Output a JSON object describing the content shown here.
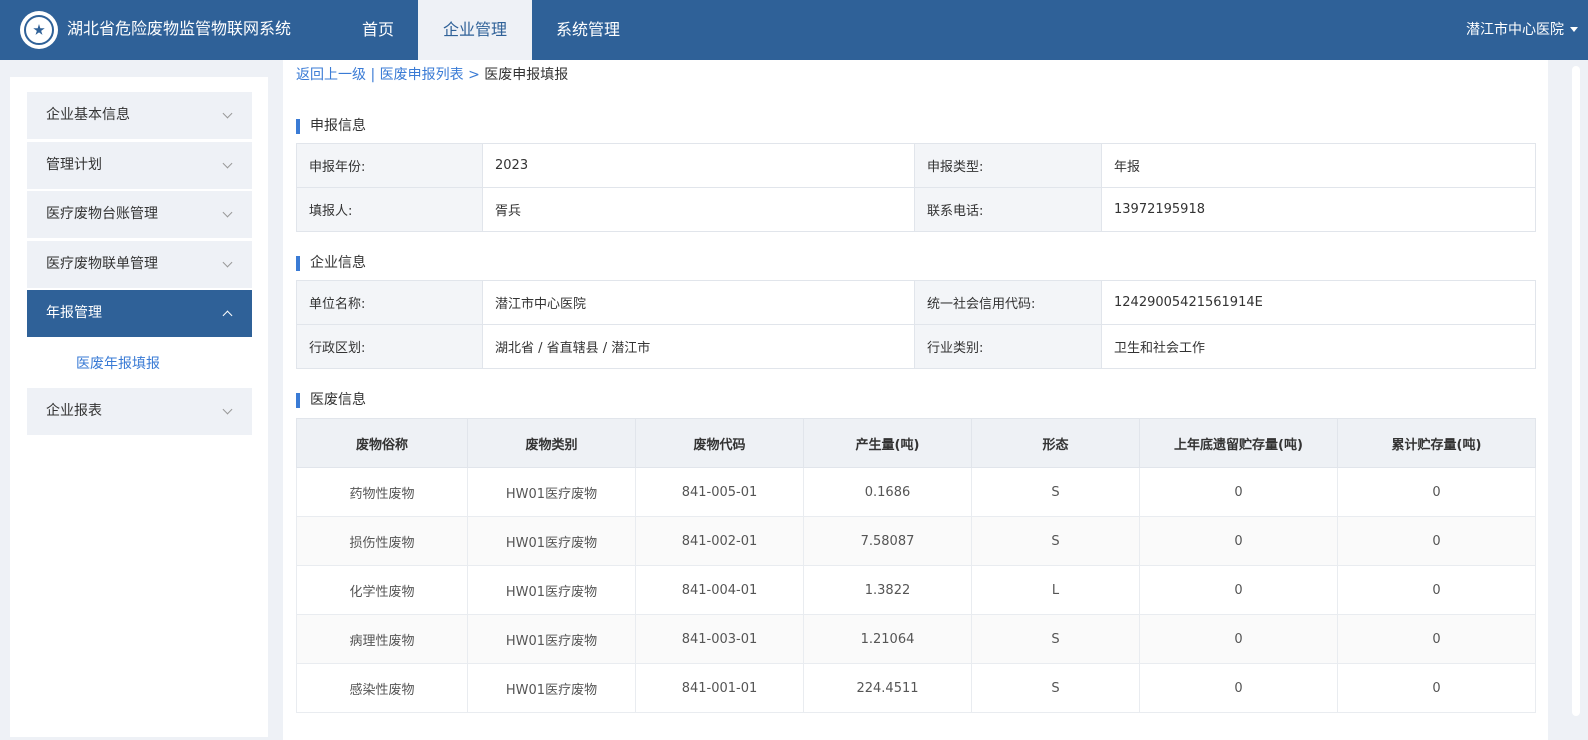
{
  "header": {
    "app_title": "湖北省危险废物监管物联网系统",
    "nav": [
      {
        "label": "首页"
      },
      {
        "label": "企业管理",
        "active": true
      },
      {
        "label": "系统管理"
      }
    ],
    "user": "潜江市中心医院"
  },
  "sidebar": {
    "items": [
      {
        "label": "企业基本信息"
      },
      {
        "label": "管理计划"
      },
      {
        "label": "医疗废物台账管理"
      },
      {
        "label": "医疗废物联单管理"
      },
      {
        "label": "年报管理",
        "active": true
      },
      {
        "label": "企业报表"
      }
    ],
    "subitem": "医废年报填报"
  },
  "breadcrumb": {
    "back": "返回上一级",
    "sep": " | ",
    "list": "医废申报列表",
    "arrow": " > ",
    "current": "医废申报填报"
  },
  "report_info": {
    "title": "申报信息",
    "year_label": "申报年份:",
    "year": "2023",
    "type_label": "申报类型:",
    "type": "年报",
    "filler_label": "填报人:",
    "filler": "胥兵",
    "phone_label": "联系电话:",
    "phone": "13972195918"
  },
  "company_info": {
    "title": "企业信息",
    "name_label": "单位名称:",
    "name": "潜江市中心医院",
    "credit_label": "统一社会信用代码:",
    "credit": "12429005421561914E",
    "region_label": "行政区划:",
    "region": "湖北省 / 省直辖县 / 潜江市",
    "industry_label": "行业类别:",
    "industry": "卫生和社会工作"
  },
  "waste_info": {
    "title": "医废信息",
    "columns": [
      "废物俗称",
      "废物类别",
      "废物代码",
      "产生量(吨)",
      "形态",
      "上年底遗留贮存量(吨)",
      "累计贮存量(吨)"
    ],
    "rows": [
      [
        "药物性废物",
        "HW01医疗废物",
        "841-005-01",
        "0.1686",
        "S",
        "0",
        "0"
      ],
      [
        "损伤性废物",
        "HW01医疗废物",
        "841-002-01",
        "7.58087",
        "S",
        "0",
        "0"
      ],
      [
        "化学性废物",
        "HW01医疗废物",
        "841-004-01",
        "1.3822",
        "L",
        "0",
        "0"
      ],
      [
        "病理性废物",
        "HW01医疗废物",
        "841-003-01",
        "1.21064",
        "S",
        "0",
        "0"
      ],
      [
        "感染性废物",
        "HW01医疗废物",
        "841-001-01",
        "224.4511",
        "S",
        "0",
        "0"
      ]
    ]
  }
}
